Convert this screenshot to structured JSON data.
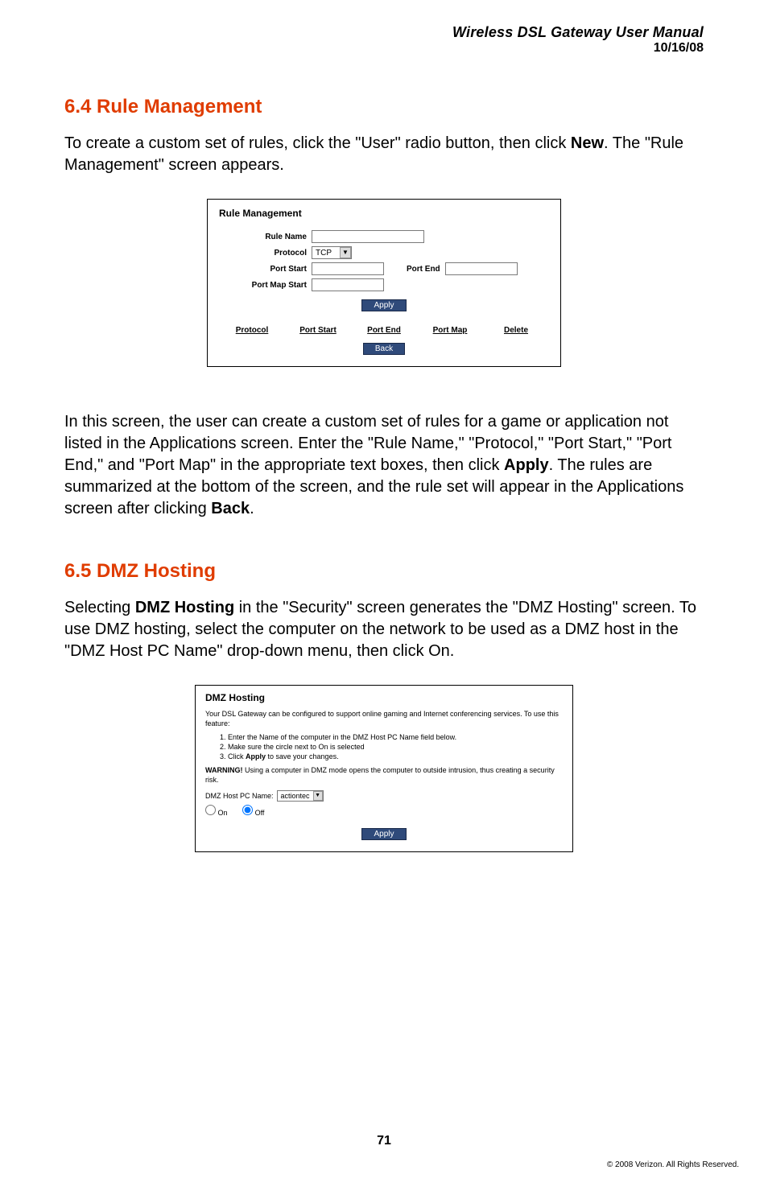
{
  "header": {
    "title": "Wireless DSL Gateway User Manual",
    "date": "10/16/08"
  },
  "section64": {
    "heading": "6.4  Rule Management",
    "intro_pre": "To create a custom set of rules, click the \"User\" radio button, then click ",
    "intro_bold": "New",
    "intro_post": ". The \"Rule Management\" screen appears.",
    "para2_a": "In this screen, the user can create a custom set of rules for a game or application not listed in the Applications screen. Enter the \"Rule Name,\" \"Protocol,\" \"Port Start,\" \"Port End,\" and \"Port Map\" in the appropriate text boxes, then click ",
    "para2_b1": "Apply",
    "para2_c": ". The rules are summarized at the bottom of the screen, and the rule set will appear in the Applications screen after clicking ",
    "para2_b2": "Back",
    "para2_d": "."
  },
  "fig1": {
    "title": "Rule Management",
    "labels": {
      "rule_name": "Rule Name",
      "protocol": "Protocol",
      "port_start": "Port Start",
      "port_end": "Port End",
      "port_map_start": "Port Map Start"
    },
    "protocol_value": "TCP",
    "buttons": {
      "apply": "Apply",
      "back": "Back"
    },
    "columns": [
      "Protocol",
      "Port Start",
      "Port End",
      "Port Map",
      "Delete"
    ]
  },
  "section65": {
    "heading": "6.5  DMZ Hosting",
    "para_a": "Selecting ",
    "para_b1": "DMZ Hosting",
    "para_c": " in the \"Security\" screen generates the \"DMZ Hosting\" screen. To use DMZ hosting, select the computer on the network to be used as a DMZ host in the \"DMZ Host PC Name\" drop-down menu, then click On."
  },
  "fig2": {
    "title": "DMZ Hosting",
    "intro": "Your DSL Gateway can be configured to support online gaming and Internet conferencing services. To use this feature:",
    "steps": [
      "Enter the Name of the computer in the DMZ Host PC Name field below.",
      "Make sure the circle next to On is selected",
      "Click Apply to save your changes."
    ],
    "step3_pre": "Click ",
    "step3_bold": "Apply",
    "step3_post": " to save your changes.",
    "warning_pre": "WARNING!",
    "warning_text": " Using a computer in DMZ mode opens the computer to outside intrusion, thus creating a security risk.",
    "host_label": "DMZ Host PC Name:",
    "host_value": "actiontec",
    "radio_on": "On",
    "radio_off": "Off",
    "apply": "Apply"
  },
  "footer": {
    "page": "71",
    "copyright": "© 2008 Verizon. All Rights Reserved."
  }
}
